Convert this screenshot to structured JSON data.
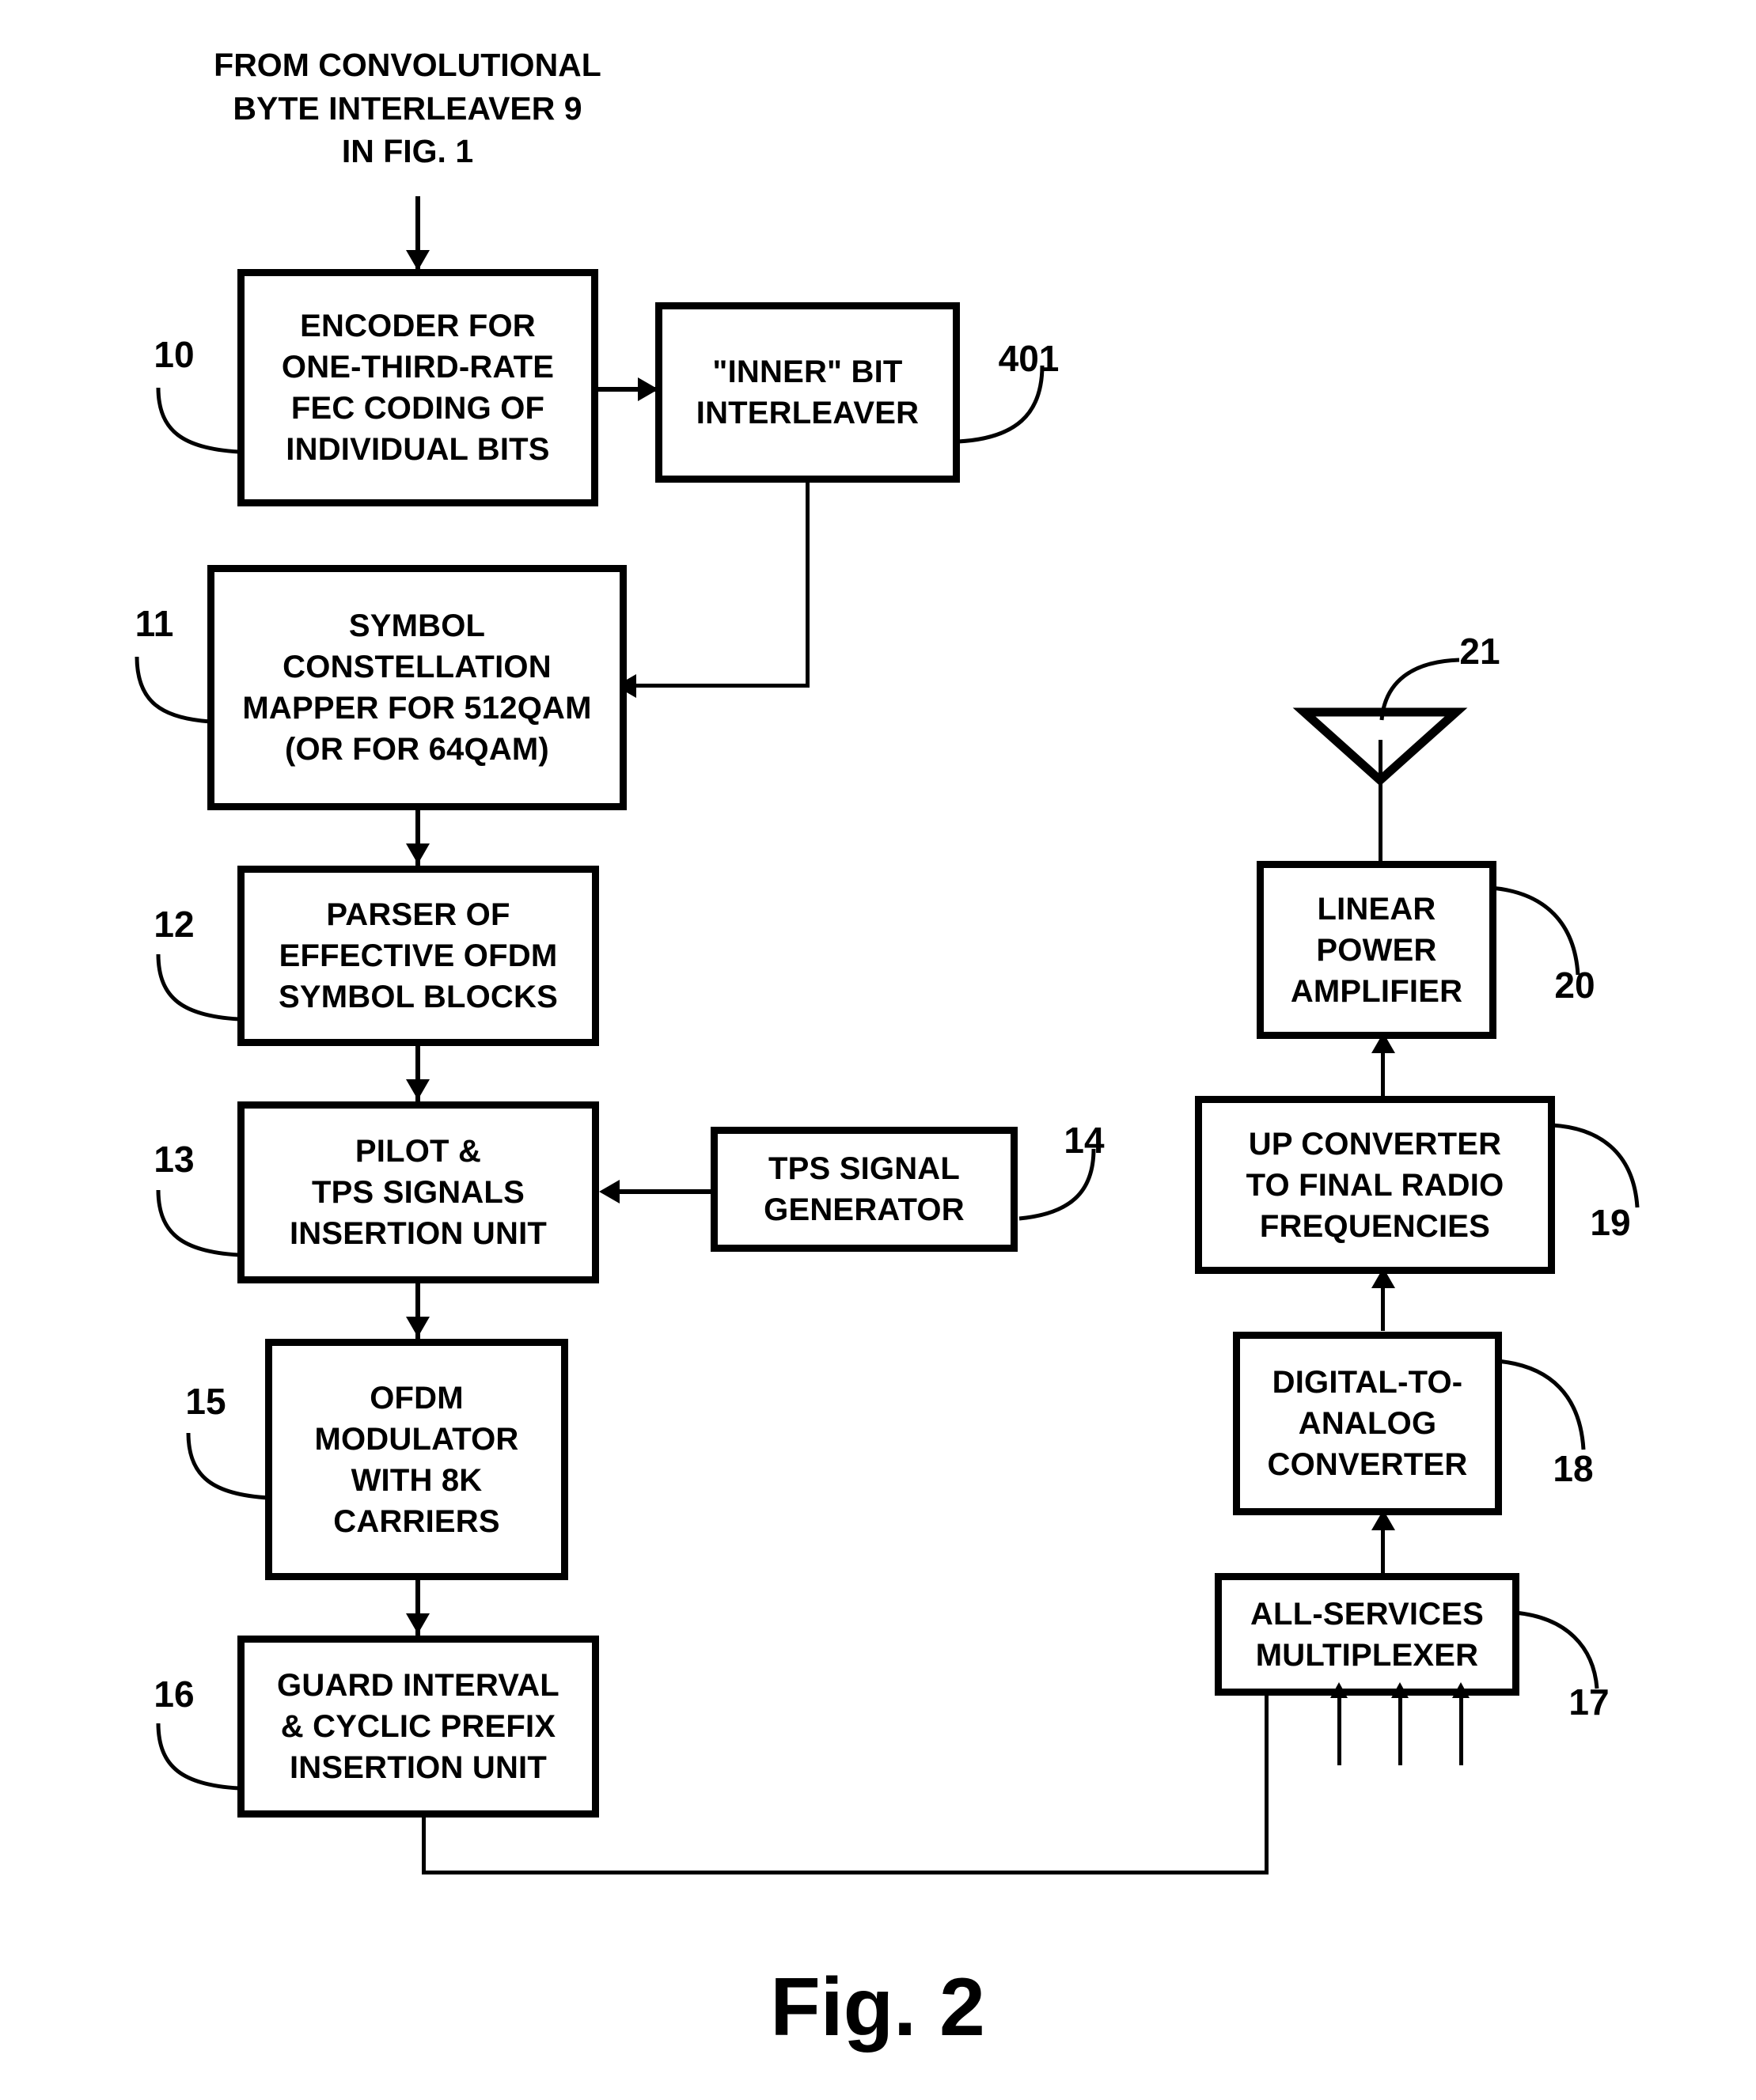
{
  "figure": {
    "caption": "Fig. 2",
    "source_note": "FROM CONVOLUTIONAL\nBYTE INTERLEAVER 9\nIN FIG. 1"
  },
  "blocks": [
    {
      "ref": "10",
      "label": "ENCODER FOR\nONE-THIRD-RATE\nFEC CODING OF\nINDIVIDUAL BITS"
    },
    {
      "ref": "401",
      "label": "\"INNER\" BIT\nINTERLEAVER"
    },
    {
      "ref": "11",
      "label": "SYMBOL\nCONSTELLATION\nMAPPER FOR 512QAM\n(OR FOR 64QAM)"
    },
    {
      "ref": "12",
      "label": "PARSER OF\nEFFECTIVE OFDM\nSYMBOL BLOCKS"
    },
    {
      "ref": "13",
      "label": "PILOT &\nTPS SIGNALS\nINSERTION UNIT"
    },
    {
      "ref": "14",
      "label": "TPS SIGNAL\nGENERATOR"
    },
    {
      "ref": "15",
      "label": "OFDM\nMODULATOR\nWITH 8K\nCARRIERS"
    },
    {
      "ref": "16",
      "label": "GUARD INTERVAL\n& CYCLIC PREFIX\nINSERTION UNIT"
    },
    {
      "ref": "17",
      "label": "ALL-SERVICES\nMULTIPLEXER"
    },
    {
      "ref": "18",
      "label": "DIGITAL-TO-\nANALOG\nCONVERTER"
    },
    {
      "ref": "19",
      "label": "UP CONVERTER\nTO FINAL RADIO\nFREQUENCIES"
    },
    {
      "ref": "20",
      "label": "LINEAR\nPOWER\nAMPLIFIER"
    },
    {
      "ref": "21",
      "label": ""
    }
  ],
  "antenna": {
    "ref": "21",
    "icon": "antenna-icon"
  },
  "colors": {
    "stroke": "#000000",
    "background": "#ffffff"
  }
}
